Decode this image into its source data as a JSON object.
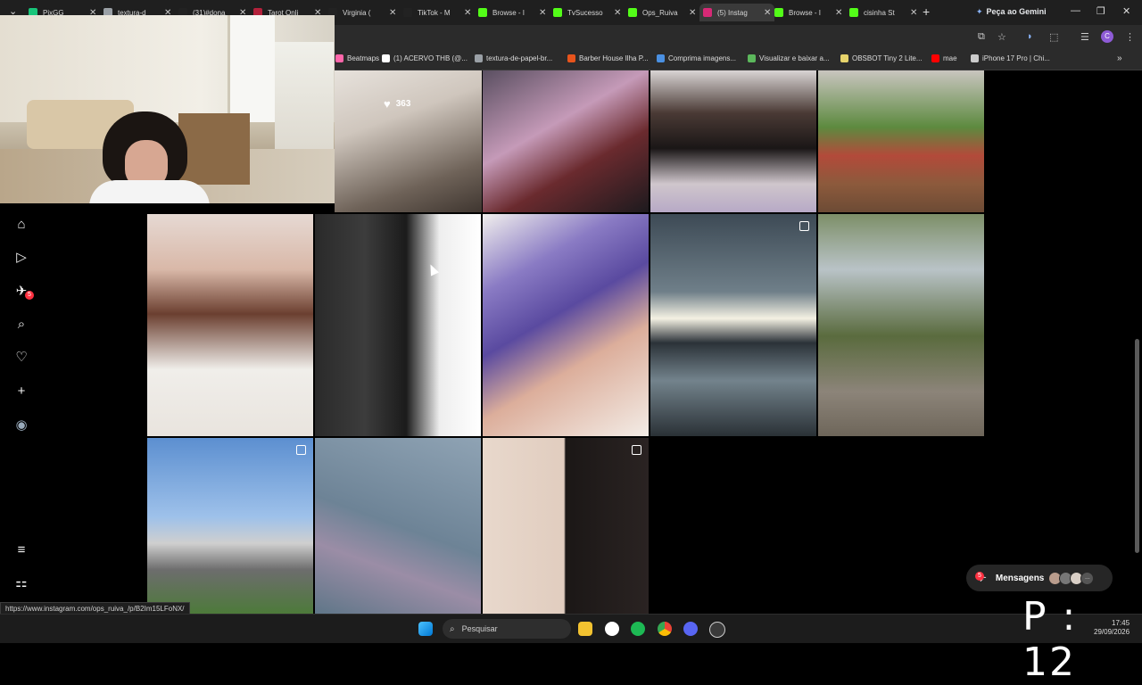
{
  "browser": {
    "tabs": [
      {
        "label": "PixGG",
        "color": "#18c57a"
      },
      {
        "label": "textura-d",
        "color": "#9aa0a6"
      },
      {
        "label": "(31)#dona",
        "color": "#222222"
      },
      {
        "label": "Tarot Onli",
        "color": "#b3213b"
      },
      {
        "label": "Virginia (",
        "color": "#222222"
      },
      {
        "label": "TikTok - M",
        "color": "#222222"
      },
      {
        "label": "Browse - I",
        "color": "#53fc18"
      },
      {
        "label": "TvSucesso",
        "color": "#53fc18"
      },
      {
        "label": "Ops_Ruiva",
        "color": "#53fc18"
      },
      {
        "label": "(5) Instag",
        "color": "#d62976"
      },
      {
        "label": "Browse - I",
        "color": "#53fc18"
      },
      {
        "label": "cisinha St",
        "color": "#53fc18"
      }
    ],
    "new_tab": "+",
    "gemini_label": "Peça ao Gemini",
    "profile_initial": "C",
    "bookmarks": [
      {
        "label": "Beatmaps",
        "color": "#ff66aa"
      },
      {
        "label": "(1) ACERVO THB (@...",
        "color": "#ffffff"
      },
      {
        "label": "textura-de-papel-br...",
        "color": "#9aa0a6"
      },
      {
        "label": "Barber House Ilha P...",
        "color": "#e8541c"
      },
      {
        "label": "Comprima imagens...",
        "color": "#4a90e2"
      },
      {
        "label": "Visualizar e baixar a...",
        "color": "#5cb85c"
      },
      {
        "label": "OBSBOT Tiny 2 Lite...",
        "color": "#e6d36b"
      },
      {
        "label": "mae",
        "color": "#ff0000"
      },
      {
        "label": "iPhone 17 Pro | Chi...",
        "color": "#cccccc"
      }
    ]
  },
  "post": {
    "likes": "363"
  },
  "sidebar": {
    "notification_count": "5"
  },
  "messages": {
    "label": "Mensagens",
    "badge": "5"
  },
  "status_url": "https://www.instagram.com/ops_ruiva_/p/B2Im15LFoNX/",
  "taskbar": {
    "search_placeholder": "Pesquisar",
    "time": "17:45",
    "date": "29/09/2026"
  },
  "overlay_counter": "P : 12",
  "colors": {
    "instagram_badge": "#ff3040",
    "page_bg": "#000000",
    "chrome_bg": "#1f1f1f"
  }
}
